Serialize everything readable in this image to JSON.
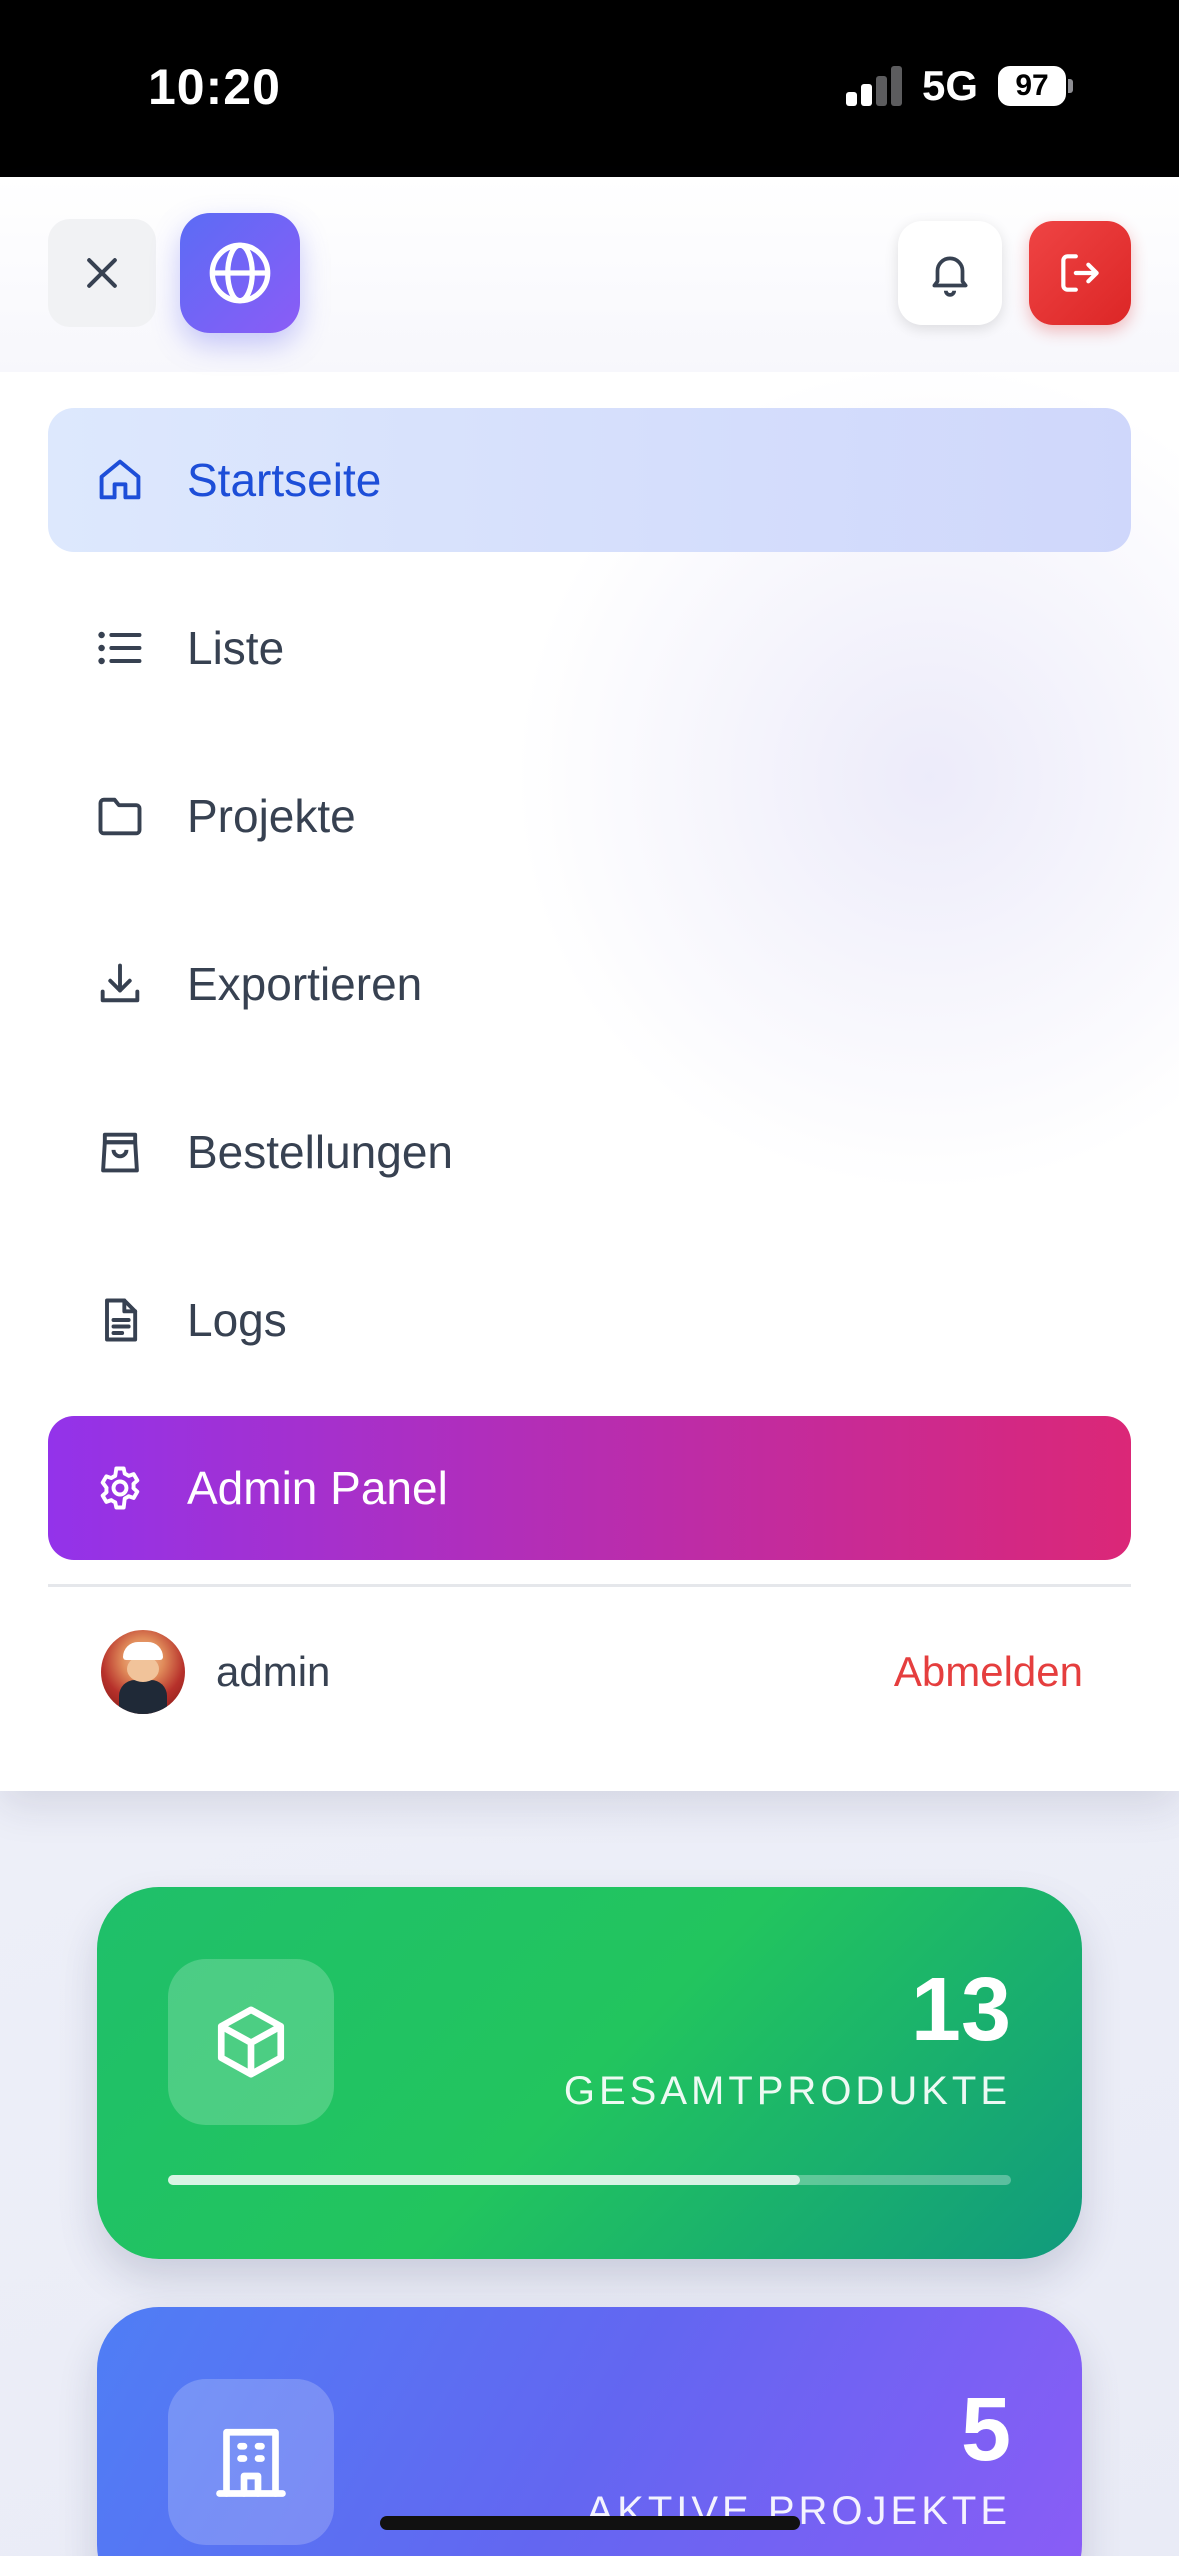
{
  "status_bar": {
    "time": "10:20",
    "network": "5G",
    "battery": "97"
  },
  "header": {
    "close_icon": "close-icon",
    "globe_icon": "globe-icon",
    "bell_icon": "bell-icon",
    "logout_icon": "logout-icon"
  },
  "nav": {
    "items": [
      {
        "label": "Startseite",
        "icon": "home-icon",
        "active": true
      },
      {
        "label": "Liste",
        "icon": "list-icon"
      },
      {
        "label": "Projekte",
        "icon": "folder-icon"
      },
      {
        "label": "Exportieren",
        "icon": "download-icon"
      },
      {
        "label": "Bestellungen",
        "icon": "shopping-bag-icon"
      },
      {
        "label": "Logs",
        "icon": "document-icon"
      }
    ],
    "admin": {
      "label": "Admin Panel",
      "icon": "gear-icon"
    }
  },
  "user": {
    "name": "admin",
    "signout_label": "Abmelden"
  },
  "stats": [
    {
      "value": "13",
      "label": "GESAMTPRODUKTE",
      "icon": "cube-icon",
      "progress": 0.75,
      "color": "#22c55e"
    },
    {
      "value": "5",
      "label": "AKTIVE PROJEKTE",
      "icon": "building-icon",
      "color": "#6366f1"
    }
  ]
}
